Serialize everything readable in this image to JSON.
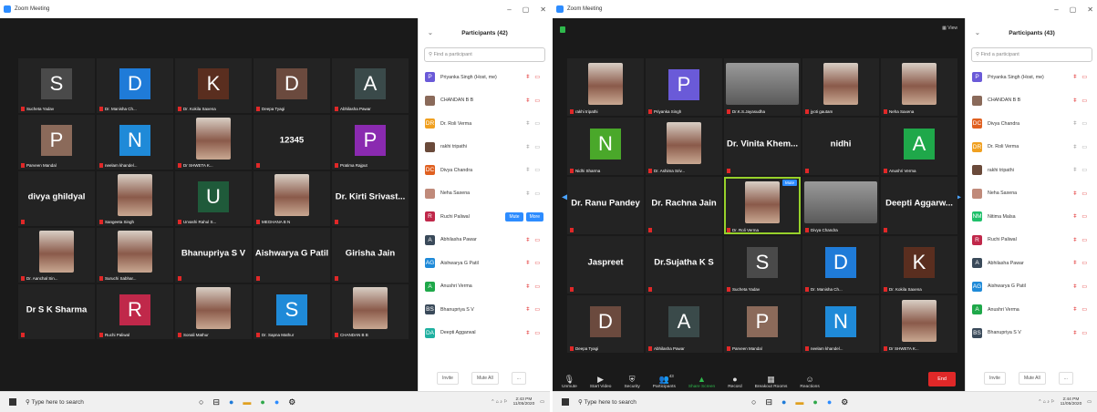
{
  "left": {
    "window_title": "Zoom Meeting",
    "participants_title": "Participants (42)",
    "search_placeholder": "Find a participant",
    "tiles": [
      {
        "type": "avatar",
        "letter": "S",
        "color": "#4a4a4a",
        "label": "Sucheta Yadav"
      },
      {
        "type": "avatar",
        "letter": "D",
        "color": "#1f7bd8",
        "label": "Dr. Manisha Ch..."
      },
      {
        "type": "avatar",
        "letter": "K",
        "color": "#5a2e1f",
        "label": "Dr. Kokila Saxena"
      },
      {
        "type": "avatar",
        "letter": "D",
        "color": "#6b4a3e",
        "label": "Deepa Tyagi"
      },
      {
        "type": "avatar",
        "letter": "A",
        "color": "#3a4a4a",
        "label": "Abhilasha Pawar"
      },
      {
        "type": "avatar",
        "letter": "P",
        "color": "#8b6a5a",
        "label": "Parveen Mandal"
      },
      {
        "type": "avatar",
        "letter": "N",
        "color": "#1f8ad8",
        "label": "neelam khandel..."
      },
      {
        "type": "photo",
        "label": "Dr SHWETA K..."
      },
      {
        "type": "name",
        "name": "12345",
        "label": ""
      },
      {
        "type": "avatar",
        "letter": "P",
        "color": "#8a2ab0",
        "label": "Pratima Rajput"
      },
      {
        "type": "name",
        "name": "divya ghildyal",
        "label": ""
      },
      {
        "type": "photo",
        "label": "Sangeeta Singh"
      },
      {
        "type": "avatar",
        "letter": "U",
        "color": "#1f5a3a",
        "label": "Urvashi Rahul S..."
      },
      {
        "type": "photo",
        "label": "MEGHANA B N"
      },
      {
        "type": "name",
        "name": "Dr. Kirti Srivast...",
        "label": ""
      },
      {
        "type": "photo",
        "label": "Dr. Aanchal Sin..."
      },
      {
        "type": "photo",
        "label": "Suruchi Sabhar..."
      },
      {
        "type": "name",
        "name": "Bhanupriya S V",
        "label": ""
      },
      {
        "type": "name",
        "name": "Aishwarya G Patil",
        "label": ""
      },
      {
        "type": "name",
        "name": "Girisha Jain",
        "label": ""
      },
      {
        "type": "name",
        "name": "Dr S K Sharma",
        "label": ""
      },
      {
        "type": "avatar",
        "letter": "R",
        "color": "#c0284a",
        "label": "Ruchi Paliwal"
      },
      {
        "type": "photo",
        "label": "Sonali Mathur"
      },
      {
        "type": "avatar",
        "letter": "S",
        "color": "#1f8ad8",
        "label": "Dr. Sapna Mathur"
      },
      {
        "type": "photo",
        "label": "CHANDAN B B"
      }
    ],
    "participants": [
      {
        "letter": "P",
        "color": "#6a5ad8",
        "name": "Priyanka Singh (Host, me)",
        "icons": "mic-video-red"
      },
      {
        "letter": "",
        "color": "#8a6a5a",
        "name": "CHANDAN B B",
        "icons": "mic-video-red"
      },
      {
        "letter": "DR",
        "color": "#f0a020",
        "name": "Dr. Roli Verma",
        "icons": "gray"
      },
      {
        "letter": "",
        "color": "#6a4a3a",
        "name": "rakhi tripathi",
        "icons": "gray"
      },
      {
        "letter": "DC",
        "color": "#e06020",
        "name": "Divya Chandra",
        "icons": "gray"
      },
      {
        "letter": "",
        "color": "#c08a7a",
        "name": "Neha Saxena",
        "icons": "gray"
      },
      {
        "letter": "R",
        "color": "#c0284a",
        "name": "Ruchi Paliwal",
        "icons": "buttons"
      },
      {
        "letter": "A",
        "color": "#3a4a5a",
        "name": "Abhilasha Pawar",
        "icons": "mic-video-red"
      },
      {
        "letter": "AG",
        "color": "#1f8ad8",
        "name": "Aishwarya G Patil",
        "icons": "mic-video-red"
      },
      {
        "letter": "A",
        "color": "#1fa84a",
        "name": "Anushri Verma",
        "icons": "mic-video-red"
      },
      {
        "letter": "BS",
        "color": "#3a4a5a",
        "name": "Bhanupriya S V",
        "icons": "mic-video-red"
      },
      {
        "letter": "DA",
        "color": "#1fb0a0",
        "name": "Deepti Aggarwal",
        "icons": "mic-video-red"
      }
    ],
    "mute_label": "Mute",
    "more_label": "More",
    "invite_label": "Invite",
    "mute_all_label": "Mute All",
    "footer_more": "...",
    "taskbar_search": "Type here to search",
    "time": "2:43 PM",
    "date": "11/05/2020"
  },
  "right": {
    "window_title": "Zoom Meeting",
    "participants_title": "Participants (43)",
    "search_placeholder": "Find a participant",
    "view_label": "View",
    "tiles": [
      {
        "type": "photo",
        "label": "rakhi tripathi"
      },
      {
        "type": "avatar",
        "letter": "P",
        "color": "#6a5ad8",
        "label": "Priyanka Singh"
      },
      {
        "type": "photowide",
        "label": "Dr.K.S.Jayasudha"
      },
      {
        "type": "photo",
        "label": "jyoti gautam"
      },
      {
        "type": "photo",
        "label": "Neha Saxena"
      },
      {
        "type": "avatar",
        "letter": "N",
        "color": "#4aa82a",
        "label": "Nidhi Sharma"
      },
      {
        "type": "photo",
        "label": "Dr. Ashima Sriv..."
      },
      {
        "type": "name",
        "name": "Dr. Vinita Khem...",
        "label": ""
      },
      {
        "type": "name",
        "name": "nidhi",
        "label": ""
      },
      {
        "type": "avatar",
        "letter": "A",
        "color": "#1fa84a",
        "label": "Anushri Verma"
      },
      {
        "type": "name",
        "name": "Dr. Ranu Pandey",
        "label": ""
      },
      {
        "type": "name",
        "name": "Dr. Rachna Jain",
        "label": ""
      },
      {
        "type": "photo",
        "label": "Dr. Roli Verma",
        "active": true
      },
      {
        "type": "photowide",
        "label": "Divya Chandra"
      },
      {
        "type": "name",
        "name": "Deepti Aggarw...",
        "label": ""
      },
      {
        "type": "name",
        "name": "Jaspreet",
        "label": ""
      },
      {
        "type": "name",
        "name": "Dr.Sujatha K S",
        "label": ""
      },
      {
        "type": "avatar",
        "letter": "S",
        "color": "#4a4a4a",
        "label": "Sucheta Yadav"
      },
      {
        "type": "avatar",
        "letter": "D",
        "color": "#1f7bd8",
        "label": "Dr. Manisha Ch..."
      },
      {
        "type": "avatar",
        "letter": "K",
        "color": "#5a2e1f",
        "label": "Dr. Kokila Saxena"
      },
      {
        "type": "avatar",
        "letter": "D",
        "color": "#6b4a3e",
        "label": "Deepa Tyagi"
      },
      {
        "type": "avatar",
        "letter": "A",
        "color": "#3a4a4a",
        "label": "Abhilasha Pawar"
      },
      {
        "type": "avatar",
        "letter": "P",
        "color": "#8b6a5a",
        "label": "Parveen Mandal"
      },
      {
        "type": "avatar",
        "letter": "N",
        "color": "#1f8ad8",
        "label": "neelam khandel..."
      },
      {
        "type": "photo",
        "label": "Dr SHWETA K..."
      }
    ],
    "participants": [
      {
        "letter": "P",
        "color": "#6a5ad8",
        "name": "Priyanka Singh (Host, me)",
        "icons": "mic-video-red"
      },
      {
        "letter": "",
        "color": "#8a6a5a",
        "name": "CHANDAN B B",
        "icons": "mic-video-red"
      },
      {
        "letter": "DC",
        "color": "#e06020",
        "name": "Divya Chandra",
        "icons": "gray"
      },
      {
        "letter": "DR",
        "color": "#f0a020",
        "name": "Dr. Roli Verma",
        "icons": "gray"
      },
      {
        "letter": "",
        "color": "#6a4a3a",
        "name": "rakhi tripathi",
        "icons": "gray"
      },
      {
        "letter": "",
        "color": "#c08a7a",
        "name": "Neha Saxena",
        "icons": "mic-video-red"
      },
      {
        "letter": "NM",
        "color": "#1fc06a",
        "name": "Nitima Malsa",
        "icons": "mic-video-red"
      },
      {
        "letter": "R",
        "color": "#c0284a",
        "name": "Ruchi Paliwal",
        "icons": "mic-video-red"
      },
      {
        "letter": "A",
        "color": "#3a4a5a",
        "name": "Abhilasha Pawar",
        "icons": "mic-video-red"
      },
      {
        "letter": "AG",
        "color": "#1f8ad8",
        "name": "Aishwarya G Patil",
        "icons": "mic-video-red"
      },
      {
        "letter": "A",
        "color": "#1fa84a",
        "name": "Anushri Verma",
        "icons": "mic-video-red"
      },
      {
        "letter": "BS",
        "color": "#3a4a5a",
        "name": "Bhanupriya S V",
        "icons": "mic-video-red"
      }
    ],
    "toolbar": [
      {
        "icon": "mic-off",
        "label": "Unmute"
      },
      {
        "icon": "video-off",
        "label": "Start Video"
      },
      {
        "icon": "shield",
        "label": "Security"
      },
      {
        "icon": "people",
        "label": "Participants",
        "count": "43"
      },
      {
        "icon": "share",
        "label": "Share Screen"
      },
      {
        "icon": "record",
        "label": "Record"
      },
      {
        "icon": "grid",
        "label": "Breakout Rooms"
      },
      {
        "icon": "smile",
        "label": "Reactions"
      }
    ],
    "end_label": "End",
    "mute_tag": "Mute",
    "invite_label": "Invite",
    "mute_all_label": "Mute All",
    "footer_more": "...",
    "taskbar_search": "Type here to search",
    "time": "2:44 PM",
    "date": "11/05/2020"
  }
}
